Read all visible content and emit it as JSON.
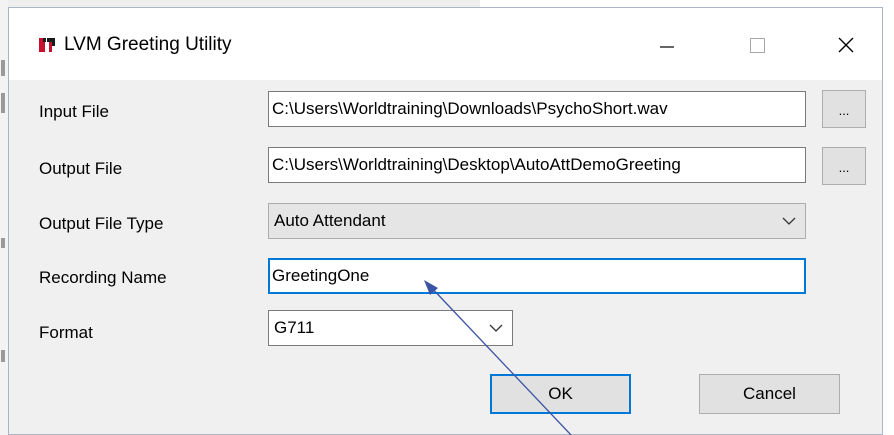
{
  "window": {
    "title": "LVM Greeting Utility"
  },
  "fields": {
    "input_file_label": "Input File",
    "input_file_value": "C:\\Users\\Worldtraining\\Downloads\\PsychoShort.wav",
    "output_file_label": "Output File",
    "output_file_value": "C:\\Users\\Worldtraining\\Desktop\\AutoAttDemoGreeting",
    "output_type_label": "Output File Type",
    "output_type_value": "Auto Attendant",
    "recording_name_label": "Recording Name",
    "recording_name_value": "GreetingOne",
    "format_label": "Format",
    "format_value": "G711"
  },
  "buttons": {
    "browse_label": "...",
    "ok_label": "OK",
    "cancel_label": "Cancel"
  },
  "colors": {
    "focus_accent": "#0078d7",
    "annotation_arrow": "#3b54a3"
  },
  "icons": {
    "app": "lvm-app-icon",
    "minimize": "minimize-icon",
    "maximize": "maximize-icon",
    "close": "close-icon",
    "dropdown": "chevron-down-icon"
  }
}
